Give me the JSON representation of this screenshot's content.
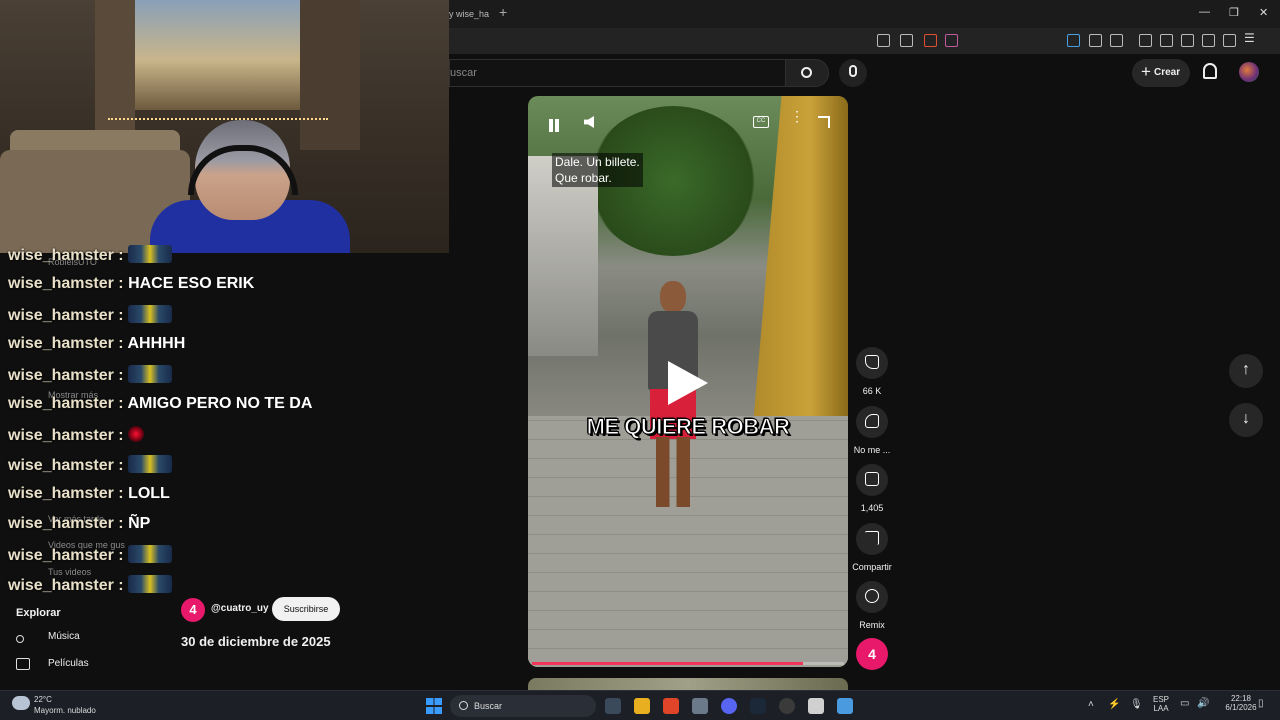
{
  "browser": {
    "tab_title": "y wise_ha",
    "new_tab": "+",
    "window_controls": [
      "—",
      "❐",
      "✕"
    ]
  },
  "youtube_header": {
    "search_placeholder": "uscar",
    "create_label": "Crear"
  },
  "chat": {
    "username": "wise_hamster",
    "separator": " : ",
    "messages": [
      {
        "user": "wise_hamster",
        "text": "",
        "emote": "minion"
      },
      {
        "user": "wise_hamster",
        "text": "HACE ESO ERIK"
      },
      {
        "user": "wise_hamster",
        "text": "",
        "emote": "minion"
      },
      {
        "user": "wise_hamster",
        "text": "AHHHH"
      },
      {
        "user": "wise_hamster",
        "text": "",
        "emote": "minion"
      },
      {
        "user": "wise_hamster",
        "text": "AMIGO PERO NO TE DA"
      },
      {
        "user": "wise_hamster",
        "text": "",
        "emote": "red"
      },
      {
        "user": "wise_hamster",
        "text": "",
        "emote": "minion"
      },
      {
        "user": "wise_hamster",
        "text": "LOLL"
      },
      {
        "user": "wise_hamster",
        "text": "ÑP"
      },
      {
        "user": "wise_hamster",
        "text": "",
        "emote": "minion"
      },
      {
        "user": "wise_hamster",
        "text": "",
        "emote": "minion"
      }
    ],
    "ghost_texts": [
      "RobleisUTO",
      "Mostrar más",
      "Ver más tarde",
      "Videos que me gus",
      "Tus videos"
    ]
  },
  "left_nav": {
    "heading": "Explorar",
    "items": [
      {
        "label": "Música",
        "icon": "music-icon"
      },
      {
        "label": "Películas",
        "icon": "film-icon"
      }
    ]
  },
  "short": {
    "channel_logo": "4",
    "channel": "@cuatro_uy",
    "subscribe_label": "Suscribirse",
    "date": "30 de diciembre de 2025",
    "caption_lines": [
      "Dale. Un billete.",
      "Que robar."
    ],
    "overlay_text": "ME QUIERE ROBAR",
    "cc_label": "CC",
    "progress": 0.87
  },
  "actions": {
    "likes": "66 K",
    "dislike_label": "No me ...",
    "comments": "1,405",
    "share_label": "Compartir",
    "remix_label": "Remix",
    "channel_badge": "4"
  },
  "taskbar": {
    "temp": "22°C",
    "weather": "Mayorm. nublado",
    "search_label": "Buscar",
    "lang_top": "ESP",
    "lang_bottom": "LAA",
    "time": "22:18",
    "date": "6/1/2026"
  }
}
